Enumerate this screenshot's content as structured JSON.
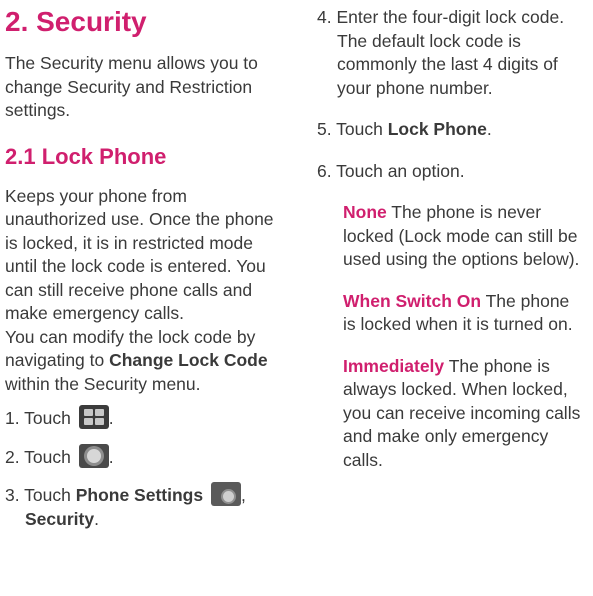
{
  "section": {
    "title": "2. Security",
    "intro": "The Security menu allows you to change Security and Restriction settings."
  },
  "subsection": {
    "title": "2.1 Lock Phone",
    "desc": "Keeps your phone from unauthorized use. Once the phone is locked, it is in restricted mode until the lock code is entered. You can still receive phone calls and make emergency calls.",
    "modify_pre": "You can modify the lock code by navigating to ",
    "modify_bold": "Change Lock Code",
    "modify_post": " within the Security menu."
  },
  "steps": {
    "s1": "1. Touch",
    "s1_end": ".",
    "s2": "2. Touch",
    "s2_end": ".",
    "s3_pre": "3. Touch ",
    "s3_bold": "Phone Settings",
    "s3_comma": ",",
    "s3_bold2": "Security",
    "s3_end": ".",
    "s4": "4. Enter the four-digit lock code. The default lock code is commonly the last 4 digits of your phone number.",
    "s5_pre": "5. Touch ",
    "s5_bold": "Lock Phone",
    "s5_end": ".",
    "s6": "6. Touch an option."
  },
  "options": [
    {
      "name": "None",
      "text": " The phone is never locked (Lock mode can still be used using the options below)."
    },
    {
      "name": "When Switch On",
      "text": " The phone is locked when it is turned on."
    },
    {
      "name": "Immediately",
      "text": " The phone is always locked. When locked, you can receive incoming calls and make only emergency calls."
    }
  ],
  "icons": [
    "menu-grid-icon",
    "settings-gear-icon",
    "phone-settings-icon"
  ],
  "colors": {
    "accent": "#d01f6e",
    "text": "#3a3a3a"
  }
}
